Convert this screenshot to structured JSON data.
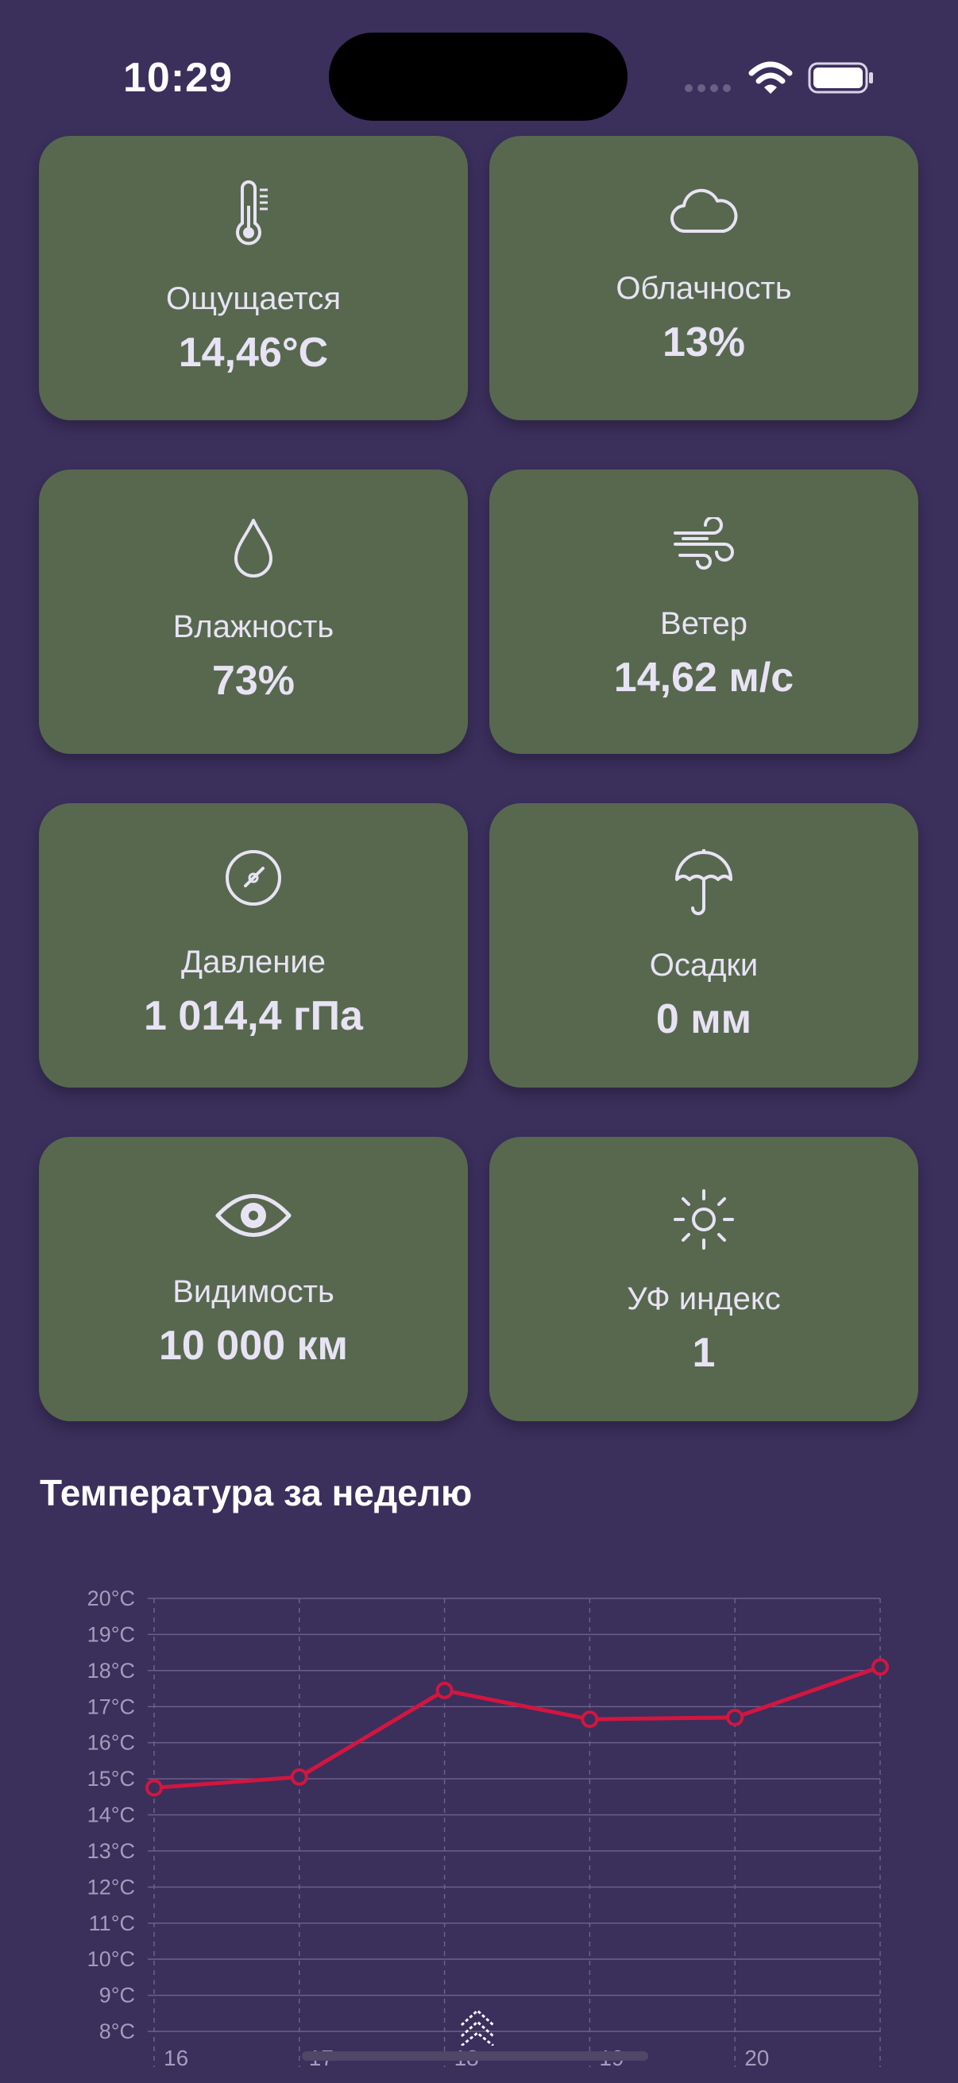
{
  "status_bar": {
    "time": "10:29"
  },
  "cards": [
    {
      "icon": "thermometer-icon",
      "label": "Ощущается",
      "value": "14,46°C"
    },
    {
      "icon": "cloud-icon",
      "label": "Облачность",
      "value": "13%"
    },
    {
      "icon": "drop-icon",
      "label": "Влажность",
      "value": "73%"
    },
    {
      "icon": "wind-icon",
      "label": "Ветер",
      "value": "14,62 м/с"
    },
    {
      "icon": "gauge-icon",
      "label": "Давление",
      "value": "1 014,4 гПа"
    },
    {
      "icon": "umbrella-icon",
      "label": "Осадки",
      "value": "0 мм"
    },
    {
      "icon": "eye-icon",
      "label": "Видимость",
      "value": "10 000 км"
    },
    {
      "icon": "sun-icon",
      "label": "УФ индекс",
      "value": "1"
    }
  ],
  "chart_section": {
    "title": "Температура за неделю"
  },
  "chart_data": {
    "type": "line",
    "x": [
      16,
      17,
      18,
      19,
      20,
      21
    ],
    "x_tick_labels": [
      "16",
      "17",
      "18",
      "19",
      "20"
    ],
    "series": [
      {
        "values": [
          14.75,
          15.05,
          17.45,
          16.65,
          16.7,
          18.1
        ],
        "color": "#d2163f"
      }
    ],
    "y_tick_labels": [
      "8°C",
      "9°C",
      "10°C",
      "11°C",
      "12°C",
      "13°C",
      "14°C",
      "15°C",
      "16°C",
      "17°C",
      "18°C",
      "19°C",
      "20°C"
    ],
    "ylim": [
      8,
      20
    ],
    "xlim": [
      16,
      21
    ],
    "grid": true
  },
  "colors": {
    "background": "#3b2f5c",
    "card": "#57684f",
    "series": "#d2163f"
  }
}
